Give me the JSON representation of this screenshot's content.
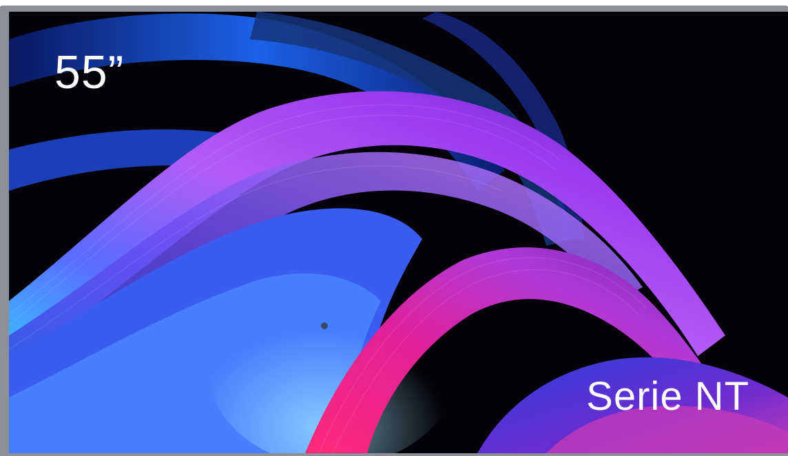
{
  "product": {
    "size_label": "55”",
    "series_label": "Serie NT"
  },
  "colors": {
    "bezel": "#8c9198",
    "screen_background": "#040208",
    "wave_blue": "#1e6cff",
    "wave_violet": "#9b3cf0",
    "wave_magenta": "#e0209a",
    "wave_cyan": "#35c8ff",
    "text": "#ffffff"
  }
}
